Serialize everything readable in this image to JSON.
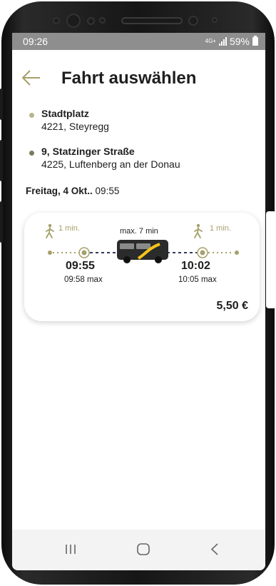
{
  "status_bar": {
    "time": "09:26",
    "network": "4G+",
    "battery_percent": "59%"
  },
  "header": {
    "title": "Fahrt auswählen",
    "back_icon": "arrow-left-icon"
  },
  "stops": [
    {
      "name": "Stadtplatz",
      "address": "4221, Steyregg",
      "dot_color": "#b8b48f"
    },
    {
      "name": "9, Statzinger Straße",
      "address": "4225, Luftenberg an der Donau",
      "dot_color": "#7d7a5a"
    }
  ],
  "date": {
    "day": "Freitag, 4 Okt..",
    "time": "09:55"
  },
  "trip": {
    "walk_before": "1 min.",
    "walk_after": "1 min.",
    "ride_duration": "max. 7 min",
    "departure": "09:55",
    "departure_max": "09:58 max",
    "arrival": "10:02",
    "arrival_max": "10:05 max",
    "price": "5,50 €"
  },
  "colors": {
    "accent": "#a6a06a",
    "route_line": "#2f3a5a",
    "bus_body": "#2b2b2b",
    "bus_stripe": "#f5c518"
  },
  "nav": {
    "recent_icon": "recent-apps-icon",
    "home_icon": "home-icon",
    "back_icon": "back-chevron-icon"
  }
}
